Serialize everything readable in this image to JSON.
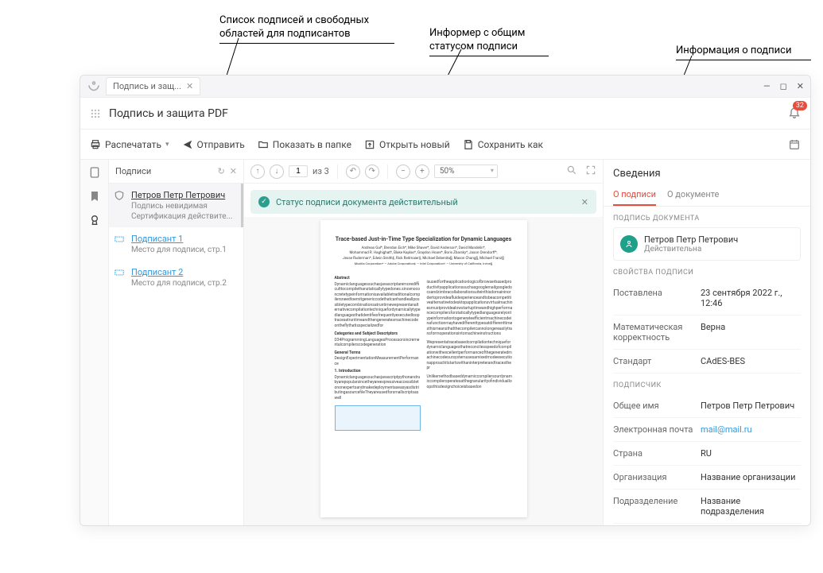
{
  "annotations": {
    "a1": "Список подписей и свободных областей для подписантов",
    "a2": "Информер с общим статусом подписи",
    "a3": "Информация о подписи"
  },
  "titlebar": {
    "tab_label": "Подпись и защ..."
  },
  "header": {
    "title": "Подпись и защита PDF",
    "notif_count": "32"
  },
  "toolbar": {
    "print": "Распечатать",
    "send": "Отправить",
    "show_folder": "Показать в папке",
    "open_new": "Открыть новый",
    "save_as": "Сохранить как"
  },
  "left_panel": {
    "title": "Подписи",
    "items": [
      {
        "name": "Петров Петр Петрович",
        "sub1": "Подпись невидимая",
        "sub2": "Сертификация действите..."
      },
      {
        "name": "Подписант 1",
        "sub1": "Место для подписи, стр.1"
      },
      {
        "name": "Подписант 2",
        "sub1": "Место для подписи, стр.2"
      }
    ]
  },
  "doc_toolbar": {
    "page_current": "1",
    "page_of": "из 3",
    "zoom": "50%"
  },
  "status_informer": {
    "text": "Статус подписи документа действительный"
  },
  "right_panel": {
    "title": "Сведения",
    "tab1": "О подписи",
    "tab2": "О документе",
    "doc_sig_label": "ПОДПИСЬ ДОКУМЕНТА",
    "signer_name": "Петров Петр Петрович",
    "signer_status": "Действительна",
    "props_label": "СВОЙСТВА ПОДПИСИ",
    "props": [
      {
        "k": "Поставлена",
        "v": "23 сентября 2022 г., 12:46"
      },
      {
        "k": "Математическая корректность",
        "v": "Верна"
      },
      {
        "k": "Стандарт",
        "v": "CAdES-BES"
      }
    ],
    "subscriber_label": "ПОДПИСЧИК",
    "subscriber": [
      {
        "k": "Общее имя",
        "v": "Петров Петр Петрович"
      },
      {
        "k": "Электронная почта",
        "v": "mail@mail.ru",
        "link": true
      },
      {
        "k": "Страна",
        "v": "RU"
      },
      {
        "k": "Организация",
        "v": "Название организации"
      },
      {
        "k": "Подразделение",
        "v": "Название подразделения"
      }
    ]
  },
  "document_preview": {
    "title": "Trace-based Just-in-Time Type Specialization for Dynamic Languages",
    "abstract_label": "Abstract",
    "intro_label": "1.  Introduction"
  }
}
